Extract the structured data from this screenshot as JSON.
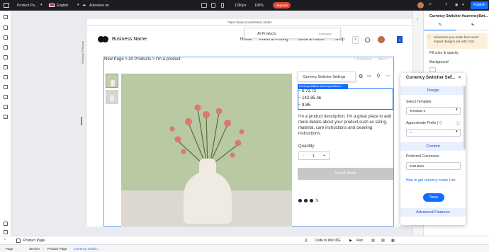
{
  "topbar": {
    "page_label": "Product Pa...",
    "language": "English",
    "autosave": "Autosave on",
    "breakpoint": "1280px",
    "zoom": "100%",
    "upgrade": "Upgrade",
    "publish": "Publish"
  },
  "canvas": {
    "url": "https://www.novadreams.studio",
    "desktop_label": "Desktop (Primary)"
  },
  "site": {
    "business_name": "Business Name",
    "nav": [
      "Home",
      "Plans & Pricing",
      "Book a Room",
      "Shop"
    ],
    "cart_count": "0",
    "all_products": "All Products",
    "category_count": "1 category",
    "breadcrumb": "New Page > All Products > I'm a product",
    "prev": "< Previous",
    "next": "Next >"
  },
  "product": {
    "widget_toolbar_label": "Currency Switcher Settings",
    "widget_tag": "Currency Switcher #currencySwitcher1",
    "prices": [
      "~ € 72.72",
      "~ 142.35 лв",
      "~ $ 85"
    ],
    "description": "I'm a product description. I'm a great place to add more details about your product such as sizing, material, care instructions and cleaning instructions.",
    "quantity_label": "Quantity",
    "quantity_value": "1",
    "out_of_stock": "Out of Stock"
  },
  "settings": {
    "title": "Currency Switcher Set...",
    "design_head": "Design",
    "select_template_label": "Select Template",
    "select_template_value": "Template 5",
    "approx_prefix_label": "Approximate Prefix (~)",
    "approx_prefix_value": "~",
    "content_head": "Content",
    "preferred_label": "Preferred Currencies",
    "preferred_value": "EUR,BGN",
    "codes_link": "How to get currency codes Link",
    "save": "Save",
    "advanced_head": "Advanced Features"
  },
  "right_panel": {
    "title": "Currency Switcher #currencySwi...",
    "notice": "Selections you make here won't impact designs set with CSS.",
    "fill_label": "Fill color & opacity",
    "background_label": "Background"
  },
  "bottom": {
    "product_page": "Product Page",
    "code_ide": "Code in Wix IDE",
    "run": "Run",
    "breadcrumbs": [
      "Page",
      "Section",
      "Product Page",
      "Currency Switch..."
    ]
  },
  "colors": {
    "accent": "#116dff",
    "upgrade": "#e4462c",
    "out_of_stock": "#c5c7ca",
    "photo_bg": "#b9c9a3"
  }
}
